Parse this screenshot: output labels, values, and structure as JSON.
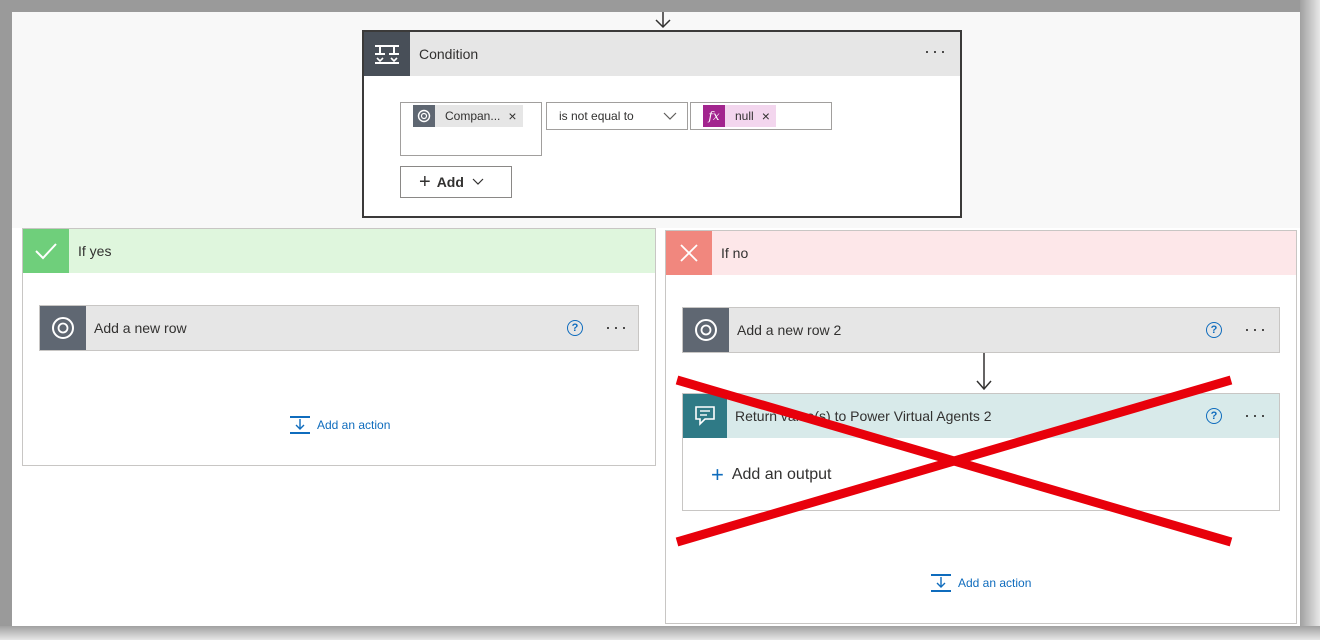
{
  "condition": {
    "title": "Condition",
    "more_label": "···",
    "left_token": {
      "label": "Compan...",
      "remove": "×"
    },
    "operator": "is not equal to",
    "right_token": {
      "fx": "fx",
      "label": "null",
      "remove": "×"
    },
    "add_label": "Add"
  },
  "if_yes": {
    "title": "If yes",
    "action": {
      "title": "Add a new row",
      "help": "?",
      "more": "···"
    },
    "add_action_label": "Add an action"
  },
  "if_no": {
    "title": "If no",
    "action": {
      "title": "Add a new row 2",
      "help": "?",
      "more": "···"
    },
    "return_action": {
      "title": "Return value(s) to Power Virtual Agents 2",
      "help": "?",
      "more": "···",
      "add_output_label": "Add an output"
    },
    "add_action_label": "Add an action"
  },
  "colors": {
    "yes_header": "#dff6dd",
    "no_header": "#fde7e9",
    "accent_blue": "#0f6cbd",
    "fx_purple": "#a2258e",
    "cross_red": "#e8000b"
  },
  "icons": [
    "condition-icon",
    "dataverse-icon",
    "fx-icon",
    "check-icon",
    "cross-icon",
    "help-icon",
    "add-action-icon",
    "pva-icon",
    "red-x-overlay"
  ]
}
